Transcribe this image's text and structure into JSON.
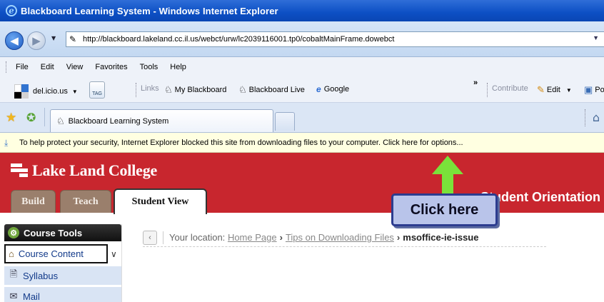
{
  "window": {
    "title": "Blackboard Learning System - Windows Internet Explorer"
  },
  "address_bar": {
    "url": "http://blackboard.lakeland.cc.il.us/webct/urw/lc2039116001.tp0/cobaltMainFrame.dowebct"
  },
  "menu": {
    "items": [
      "File",
      "Edit",
      "View",
      "Favorites",
      "Tools",
      "Help"
    ]
  },
  "links_bar": {
    "delicious_label": "del.icio.us",
    "tag_label": "TAG",
    "links_label": "Links",
    "links": [
      "My Blackboard",
      "Blackboard Live",
      "Google"
    ],
    "chevron": "»",
    "contribute_label": "Contribute",
    "edit_label": "Edit",
    "post_label": "Po"
  },
  "tabs": {
    "active_tab": "Blackboard Learning System"
  },
  "info_bar": {
    "message": "To help protect your security, Internet Explorer blocked this site from downloading files to your computer. Click here for options..."
  },
  "blackboard": {
    "college_name": "Lake Land College",
    "tabs": [
      "Build",
      "Teach",
      "Student View"
    ],
    "course_title": "Student Orientation"
  },
  "sidebar": {
    "header": "Course Tools",
    "selected": "Course Content",
    "items": [
      "Syllabus",
      "Mail"
    ]
  },
  "location": {
    "prefix": "Your location:",
    "crumbs": [
      "Home Page",
      "Tips on Downloading Files"
    ],
    "current": "msoffice-ie-issue"
  },
  "annotation": {
    "callout_text": "Click here",
    "arrow_color": "#7ae23a"
  },
  "colors": {
    "header_red": "#c8262e",
    "titlebar_blue": "#0c4fc4",
    "infobar_yellow": "#ffffe1"
  }
}
